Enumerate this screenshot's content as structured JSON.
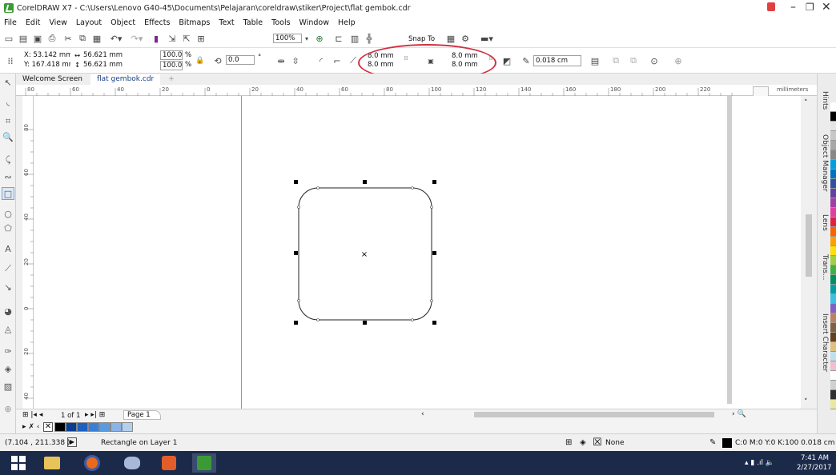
{
  "window": {
    "title": "CorelDRAW X7 - C:\\Users\\Lenovo G40-45\\Documents\\Pelajaran\\coreldraw\\stiker\\Project\\flat gembok.cdr"
  },
  "menu": [
    "File",
    "Edit",
    "View",
    "Layout",
    "Object",
    "Effects",
    "Bitmaps",
    "Text",
    "Table",
    "Tools",
    "Window",
    "Help"
  ],
  "toolbar": {
    "zoom": "100%",
    "snap_to": "Snap To"
  },
  "properties": {
    "x": "X: 53.142 mm",
    "y": "Y: 167.418 mm",
    "width": "56.621 mm",
    "height": "56.621 mm",
    "scale_x": "100.0",
    "scale_y": "100.0",
    "percent": "%",
    "rotation": "0.0",
    "degree": "°",
    "corner_tl": "8.0 mm",
    "corner_bl": "8.0 mm",
    "corner_tr": "8.0 mm",
    "corner_br": "8.0 mm",
    "outline_width": "0.018 cm"
  },
  "tabs": [
    "Welcome Screen",
    "flat gembok.cdr"
  ],
  "ruler": {
    "unit": "millimeters",
    "h_ticks": [
      "80",
      "60",
      "40",
      "20",
      "0",
      "20",
      "40",
      "60",
      "80",
      "100",
      "120",
      "140",
      "160",
      "180",
      "200",
      "220"
    ],
    "v_ticks": [
      "80",
      "60",
      "40",
      "20",
      "0",
      "20",
      "40"
    ],
    "v_unit": "millimeters"
  },
  "dock": {
    "hints": "Hints",
    "object_manager": "Object Manager",
    "lens": "Lens",
    "trans": "Trans...",
    "insert_character": "Insert Character"
  },
  "page_nav": {
    "count": "1 of 1",
    "page": "Page 1"
  },
  "status": {
    "coords": "(7.104 , 211.338 )",
    "object": "Rectangle on Layer 1",
    "fill": "None",
    "outline": "C:0 M:0 Y:0 K:100  0.018 cm"
  },
  "taskbar": {
    "time": "7:41 AM",
    "date": "2/27/2017"
  },
  "colors": {
    "accent": "#1a3f8a",
    "highlight": "#d03040"
  },
  "palette": [
    "#ffffff",
    "#000000",
    "#e6e6e6",
    "#c8c8c8",
    "#a8a8a8",
    "#888888",
    "#00a0e0",
    "#0070c0",
    "#3050a0",
    "#6040a0",
    "#a040a0",
    "#e040a0",
    "#e02040",
    "#ff6000",
    "#ffa000",
    "#ffe000",
    "#a0d040",
    "#40b040",
    "#009060",
    "#00a0a0",
    "#40c0e0",
    "#8060c0",
    "#c08060",
    "#806040",
    "#604020",
    "#e0c080",
    "#c0e0f0",
    "#f0c0d0",
    "#ffffff",
    "#d0d0d0",
    "#303030",
    "#e8e8a0"
  ],
  "bottom_swatches": [
    "#000000",
    "#0b3d91",
    "#1e5fbf",
    "#3a7fd5",
    "#5a9be0",
    "#8ab4e8",
    "#b4cfee"
  ]
}
